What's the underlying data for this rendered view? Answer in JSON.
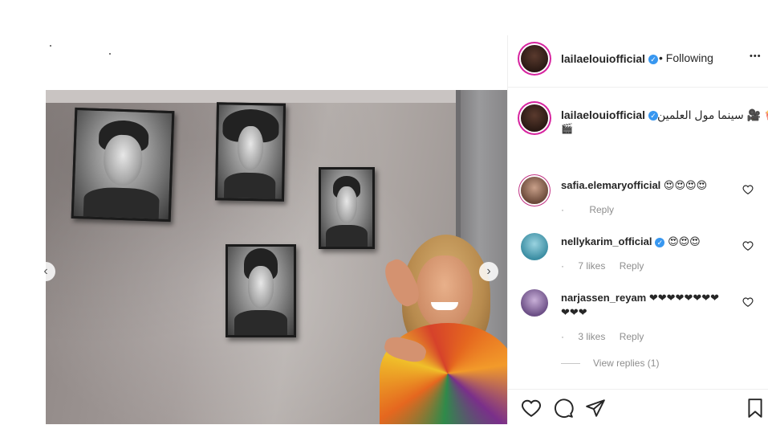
{
  "post": {
    "author": "lailaelouiofficial",
    "follow_separator": "•",
    "follow_status": "Following",
    "more_label": "•••",
    "caption": "سينما مول العلمين 🎥 🍿",
    "caption_overflow": "🎬",
    "verified_mark": "✓"
  },
  "comments": [
    {
      "user": "safia.elemaryofficial",
      "text": "😍😍😍😍",
      "likes": "",
      "reply_label": "Reply"
    },
    {
      "user": "nellykarim_official",
      "text": "😍😍😍",
      "likes": "7 likes",
      "reply_label": "Reply",
      "verified": true
    },
    {
      "user": "narjassen_reyam",
      "text": "❤❤❤❤❤❤❤❤",
      "text_overflow": "❤❤❤",
      "likes": "3 likes",
      "reply_label": "Reply"
    }
  ],
  "view_replies": "View replies (1)",
  "carousel": {
    "prev_icon": "‹",
    "next_icon": "›"
  },
  "colors": {
    "verified": "#3897f0",
    "story_ring": "#d6249f",
    "meta_text": "#8e8e8e"
  }
}
